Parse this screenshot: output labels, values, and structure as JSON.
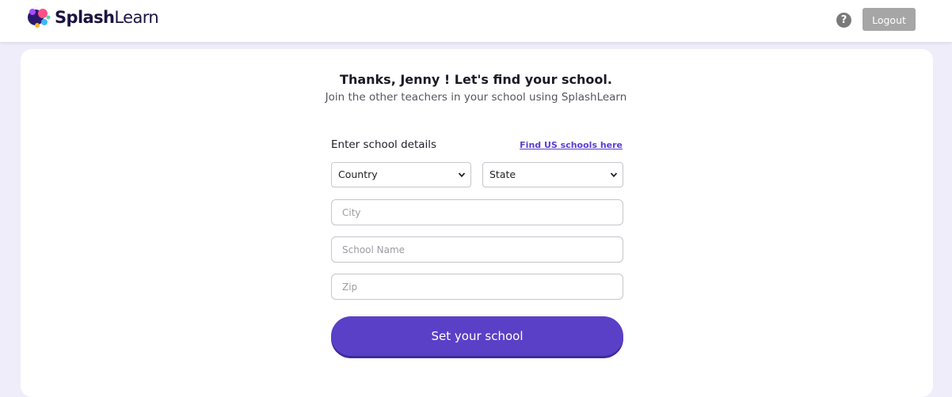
{
  "header": {
    "logo_bold": "Splash",
    "logo_light": "Learn",
    "help_glyph": "?",
    "logout_label": "Logout"
  },
  "main": {
    "title": "Thanks, Jenny ! Let's find your school.",
    "subtitle": "Join the other teachers in your school using SplashLearn",
    "section_label": "Enter school details",
    "find_link": "Find US schools here",
    "country_select": "Country",
    "state_select": "State",
    "city_placeholder": "City",
    "school_placeholder": "School Name",
    "zip_placeholder": "Zip",
    "submit_label": "Set your school"
  },
  "colors": {
    "accent": "#5a40c7",
    "link": "#5b3fd1",
    "page_bg": "#efedfa",
    "logout_bg": "#a6a6a6"
  },
  "icons": [
    "splashlearn-logo-icon",
    "help-icon",
    "chevron-down-icon"
  ]
}
